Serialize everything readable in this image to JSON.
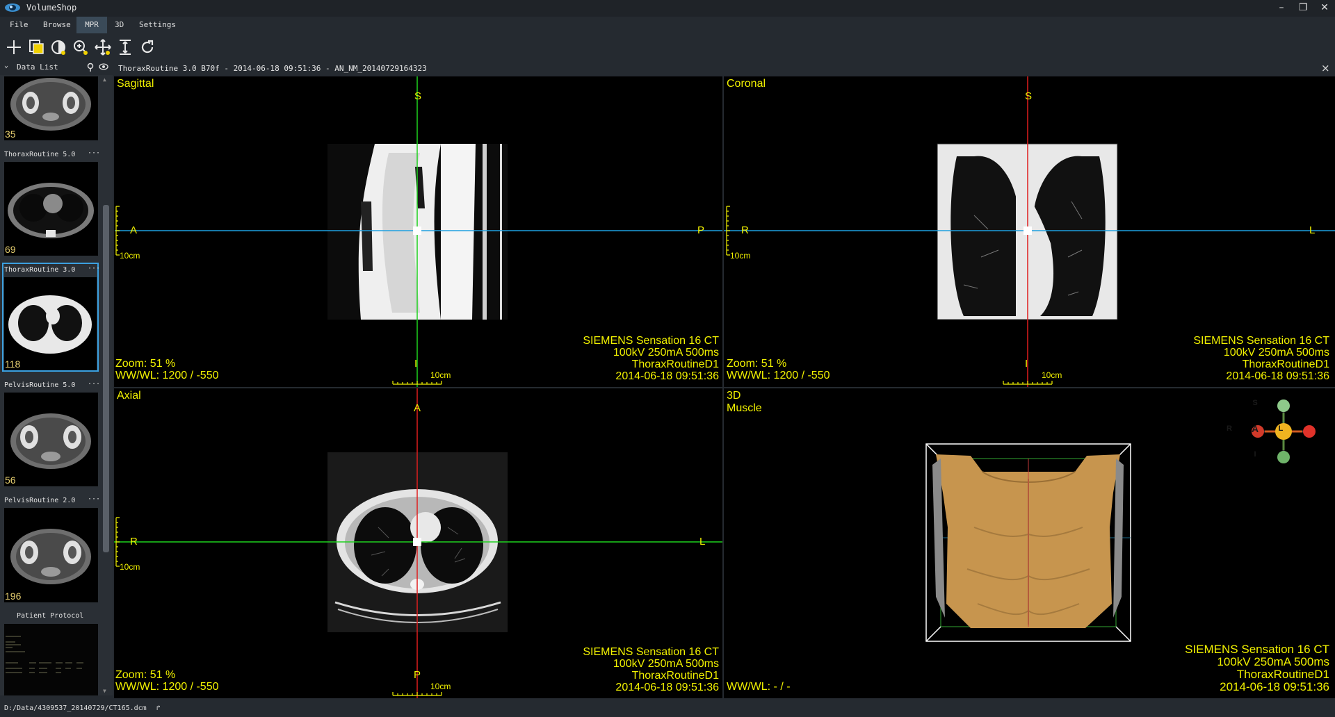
{
  "app": {
    "title": "VolumeShop",
    "window_buttons": [
      "minimize",
      "restore",
      "close"
    ]
  },
  "menu": [
    "File",
    "Browse",
    "MPR",
    "3D",
    "Settings"
  ],
  "menu_active": "MPR",
  "toolbar": [
    "crosshair-icon",
    "copy-layers-icon",
    "contrast-icon",
    "zoom-icon",
    "pan-icon",
    "slab-thickness-icon",
    "reset-icon"
  ],
  "datalist": {
    "title": "Data List",
    "series": [
      {
        "label": "",
        "count": "35"
      },
      {
        "label": "ThoraxRoutine  5.0",
        "count": "69"
      },
      {
        "label": "ThoraxRoutine  3.0",
        "count": "118",
        "selected": true
      },
      {
        "label": "PelvisRoutine  5.0",
        "count": "56"
      },
      {
        "label": "PelvisRoutine  2.0",
        "count": "196"
      }
    ],
    "protocol_title": "Patient Protocol",
    "more": "···"
  },
  "tab": {
    "title": "ThoraxRoutine  3.0  B70f - 2014-06-18 09:51:36 - AN_NM_20140729164323",
    "close": "×"
  },
  "views": {
    "sagittal": {
      "name": "Sagittal",
      "top": "S",
      "bottom": "I",
      "left": "A",
      "right": "P",
      "scale": "10cm",
      "zoom": "Zoom: 51 %",
      "wwwl": "WW/WL: 1200 / -550"
    },
    "coronal": {
      "name": "Coronal",
      "top": "S",
      "bottom": "I",
      "left": "R",
      "right": "L",
      "scale": "10cm",
      "zoom": "Zoom: 51 %",
      "wwwl": "WW/WL: 1200 / -550"
    },
    "axial": {
      "name": "Axial",
      "top": "A",
      "bottom": "P",
      "left": "R",
      "right": "L",
      "scale": "10cm",
      "zoom": "Zoom: 51 %",
      "wwwl": "WW/WL: 1200 / -550"
    },
    "threed": {
      "name": "3D",
      "preset": "Muscle",
      "wwwl": "WW/WL: - / -",
      "orient": {
        "s": "S",
        "i": "I",
        "r": "R",
        "l": "L",
        "a": "A"
      }
    }
  },
  "scanner_info": [
    "SIEMENS  Sensation 16  CT",
    "100kV  250mA  500ms",
    "ThoraxRoutineD1",
    "2014-06-18 09:51:36"
  ],
  "status": {
    "path": "D:/Data/4309537_20140729/CT165.dcm",
    "arrow": "↱"
  },
  "colors": {
    "overlay": "#f2f200",
    "axis_green": "#1ed21e",
    "axis_red": "#e01e1e",
    "axis_blue": "#1ea0e0",
    "bone": "#c7954e"
  }
}
